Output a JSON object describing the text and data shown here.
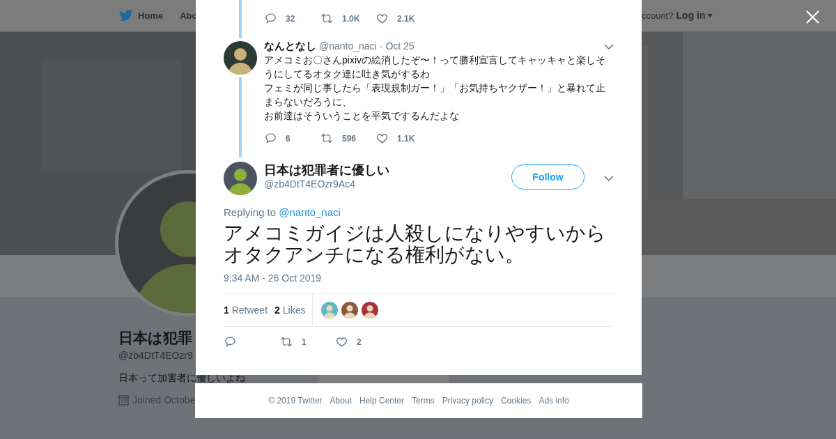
{
  "nav": {
    "items": [
      {
        "label": "Home"
      },
      {
        "label": "Abo"
      }
    ],
    "account_prompt": "ccount?",
    "login": "Log in"
  },
  "profile": {
    "name": "日本は犯罪",
    "handle": "@zb4DtT4EOzr9",
    "bio": "日本って加害者に優しいよね",
    "joined": "Joined Octobe"
  },
  "modal": {
    "first_tweet_actions": {
      "replies": "32",
      "retweets": "1.0K",
      "likes": "2.1K"
    },
    "parent_tweet": {
      "name": "なんとなし",
      "handle": "@nanto_naci",
      "separator": "·",
      "date": "Oct 25",
      "paragraphs": [
        "アメコミお〇さんpixivの絵消したぞ〜！って勝利宣言してキャッキャと楽しそうにしてるオタク達に吐き気がするわ",
        "フェミが同じ事したら「表現規制ガー！」「お気持ちヤクザー！」と暴れて止まらないだろうに、",
        "お前達はそういうことを平気でするんだよな"
      ],
      "actions": {
        "replies": "6",
        "retweets": "596",
        "likes": "1.1K"
      }
    },
    "main_tweet": {
      "name": "日本は犯罪者に優しい",
      "handle": "@zb4DtT4EOzr9Ac4",
      "follow": "Follow",
      "replying_prefix": "Replying to",
      "replying_to": "@nanto_naci",
      "text": "アメコミガイジは人殺しになりやすいからオタクアンチになる権利がない。",
      "timestamp": "9:34 AM - 26 Oct 2019",
      "retweet_count": "1",
      "retweet_label": "Retweet",
      "likes_count": "2",
      "likes_label": "Likes",
      "liker_avatars": [
        {
          "kind": "avatar",
          "color": "#5fb7c4"
        },
        {
          "kind": "avatar",
          "color": "#8a5a3c"
        },
        {
          "kind": "avatar",
          "color": "#a8333b"
        }
      ],
      "actions": {
        "retweets": "1",
        "likes": "2"
      }
    }
  },
  "footer": [
    "© 2019 Twitter",
    "About",
    "Help Center",
    "Terms",
    "Privacy policy",
    "Cookies",
    "Ads info"
  ]
}
